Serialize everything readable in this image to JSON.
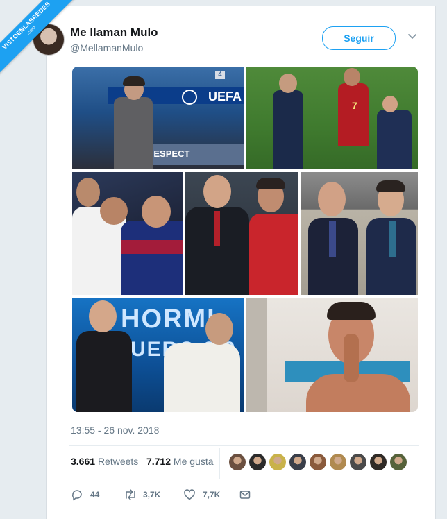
{
  "banner": {
    "line1": "VISTOENLASREDES",
    "line2": ".com"
  },
  "tweet": {
    "author_name": "Me llaman Mulo",
    "author_handle": "@MellamanMulo",
    "follow_label": "Seguir",
    "timestamp": "13:55 - 26 nov. 2018",
    "retweets_count": "3.661",
    "retweets_label": "Retweets",
    "likes_count": "7.712",
    "likes_label": "Me gusta",
    "liker_colors": [
      "#6b5040",
      "#2b2b2b",
      "#c9b24a",
      "#3a3f4a",
      "#8a5a3c",
      "#b08a50",
      "#4a4a4a",
      "#2f2a26",
      "#56623a"
    ]
  },
  "collage": {
    "photo1_banner_text": "UEFA",
    "photo1_board_text": "RESPECT",
    "photo1_screen_number": "4",
    "photo2_shirt_number": "7",
    "photo5_title_1": "HORMI",
    "photo5_title_2": "UERO 3.0"
  },
  "actions": {
    "reply_count": "44",
    "retweet_count": "3,7K",
    "like_count": "7,7K"
  },
  "icons": {
    "reply": "reply-icon",
    "retweet": "retweet-icon",
    "like": "heart-icon",
    "message": "envelope-icon",
    "menu": "chevron-down-icon"
  },
  "colors": {
    "accent": "#1da1f2",
    "muted": "#657786",
    "background": "#e6ecf0"
  }
}
